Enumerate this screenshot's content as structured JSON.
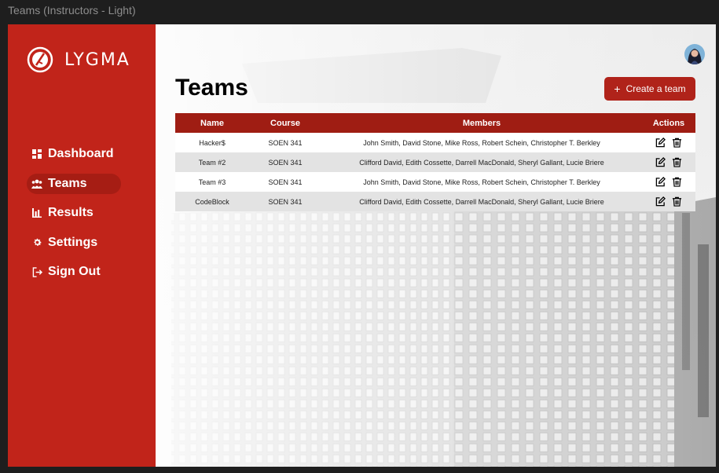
{
  "window": {
    "title": "Teams (Instructors - Light)"
  },
  "brand": {
    "name": "LYGMA"
  },
  "nav": [
    {
      "label": "Dashboard",
      "icon": "dashboard-icon",
      "active": false
    },
    {
      "label": "Teams",
      "icon": "people-icon",
      "active": true
    },
    {
      "label": "Results",
      "icon": "bar-chart-icon",
      "active": false
    },
    {
      "label": "Settings",
      "icon": "gear-icon",
      "active": false
    },
    {
      "label": "Sign Out",
      "icon": "sign-out-icon",
      "active": false
    }
  ],
  "page": {
    "title": "Teams",
    "create_label": "Create a team"
  },
  "table": {
    "headers": [
      "Name",
      "Course",
      "Members",
      "Actions"
    ],
    "rows": [
      {
        "name": "Hacker$",
        "course": "SOEN 341",
        "members": "John Smith,  David Stone, Mike Ross, Robert Schein, Christopher T. Berkley"
      },
      {
        "name": "Team #2",
        "course": "SOEN 341",
        "members": "Clifford David, Edith Cossette, Darrell MacDonald, Sheryl Gallant, Lucie Briere"
      },
      {
        "name": "Team #3",
        "course": "SOEN 341",
        "members": "John Smith,  David Stone, Mike Ross, Robert Schein, Christopher T. Berkley"
      },
      {
        "name": "CodeBlock",
        "course": "SOEN 341",
        "members": "Clifford David, Edith Cossette, Darrell MacDonald, Sheryl Gallant, Lucie Briere"
      }
    ]
  },
  "colors": {
    "sidebar": "#c1241a",
    "accent": "#9f1d13",
    "button": "#b0231a"
  }
}
